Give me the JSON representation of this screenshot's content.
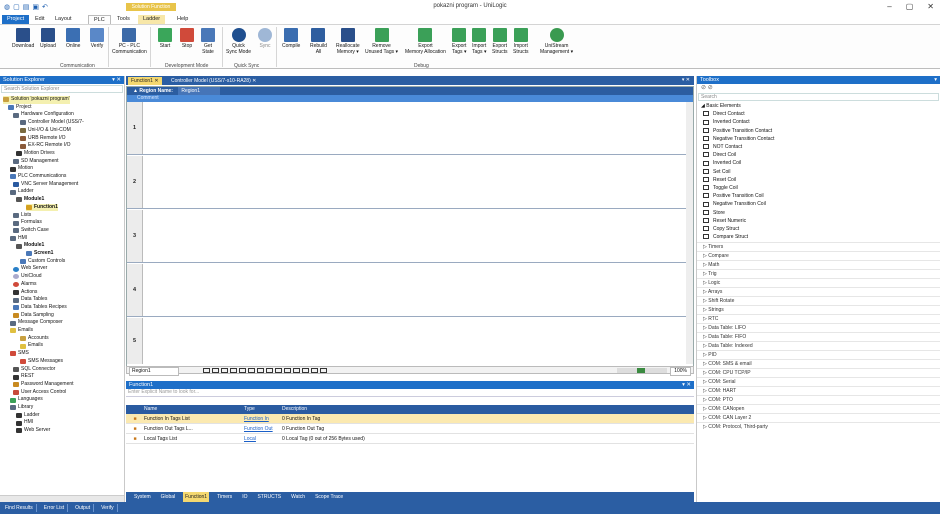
{
  "titlebar": {
    "ctx_tab": "Solution Function",
    "title": "pokazni program - UniLogic",
    "ctrl": [
      "–",
      "▢",
      "✕"
    ]
  },
  "menutabs": [
    "Project",
    "Edit",
    "Layout",
    "PLC",
    "Tools",
    "Ladder",
    "Help"
  ],
  "ribbon": {
    "buttons": [
      "Download",
      "Upload",
      "Online",
      "Verify",
      "PC - PLC\nCommunication",
      "Start",
      "Stop",
      "Get\nState",
      "Quick\nSync Mode",
      "Sync",
      "Compile",
      "Rebuild\nAll",
      "Reallocate\nMemory ▾",
      "Remove\nUnused Tags ▾",
      "Export\nMemory Allocation",
      "Export\nTags ▾",
      "Import\nTags ▾",
      "Export\nStructs",
      "Import\nStructs",
      "UniStream\nManagement ▾"
    ],
    "groups": [
      "Communication",
      "Development Mode",
      "Quick Sync",
      "Debug"
    ]
  },
  "solution": {
    "title": "Solution Explorer",
    "search_placeholder": "Search Solution Explorer",
    "tree": [
      "Solution 'pokazni program'",
      "Project",
      "Hardware Configuration",
      "Controller Model (USS/7-",
      "Uni-I/O & Uni-COM",
      "URB Remote I/O",
      "EX-RC Remote I/O",
      "Motion Drives",
      "SD Management",
      "Motion",
      "PLC Communications",
      "VNC Server Management",
      "Ladder",
      "Module1",
      "Function1",
      "Lists",
      "Formulas",
      "Switch Case",
      "HMI",
      "Module1",
      "Screen1",
      "Custom Controls",
      "Web Server",
      "UniCloud",
      "Alarms",
      "Actions",
      "Data Tables",
      "Data Tables Recipes",
      "Data Sampling",
      "Message Composer",
      "Emails",
      "Accounts",
      "Emails",
      "SMS",
      "SMS Messages",
      "SQL Connector",
      "REST",
      "Password Management",
      "User Access Control",
      "Languages",
      "Library",
      "Ladder",
      "HMI",
      "Web Server"
    ]
  },
  "doctabs": [
    "Function1 ✕",
    "Controller Model (USS/7-s10-RA28) ✕"
  ],
  "ladder": {
    "region_label": "Region Name:",
    "region_value": "Region1",
    "comment": "Comment",
    "rungs": [
      "1",
      "2",
      "3",
      "4",
      "5"
    ],
    "region_select": "Region1",
    "zoom": "100%"
  },
  "function_panel": {
    "title": "Function1",
    "filter_placeholder": "Enter Explicit Name to look for...",
    "headers": [
      "Name",
      "Type",
      "Description"
    ],
    "rows": [
      {
        "name": "Function In Tags List",
        "type": "Function In",
        "desc": "0 Function In Tag"
      },
      {
        "name": "Function Out Tags L...",
        "type": "Function Out",
        "desc": "0 Function Out Tag"
      },
      {
        "name": "Local Tags List",
        "type": "Local",
        "desc": "0 Local Tag (0 out of 256 Bytes used)"
      }
    ]
  },
  "bottom_tabs": [
    "System",
    "Global",
    "Function1",
    "Timers",
    "IO",
    "STRUCTS",
    "Watch",
    "Scope Trace"
  ],
  "status_tabs": [
    "Find Results",
    "Error List",
    "Output",
    "Verify"
  ],
  "toolbox": {
    "title": "Toolbox",
    "search": "Search",
    "section": "Basic Elements",
    "elements": [
      "Direct Contact",
      "Inverted Contact",
      "Positive Transition Contact",
      "Negative Transition Contact",
      "NOT Contact",
      "Direct Coil",
      "Inverted Coil",
      "Set Coil",
      "Reset Coil",
      "Toggle Coil",
      "Positive Transition Coil",
      "Negative Transition Coil",
      "Store",
      "Reset Numeric",
      "Copy Struct",
      "Compare Struct"
    ],
    "categories": [
      "Timers",
      "Compare",
      "Math",
      "Trig",
      "Logic",
      "Arrays",
      "Shift Rotate",
      "Strings",
      "RTC",
      "Data Table: LIFO",
      "Data Table: FIFO",
      "Data Table: Indexed",
      "PID",
      "COM: SMS & email",
      "COM: CPU TCP/IP",
      "COM: Serial",
      "COM: HART",
      "COM: PTO",
      "COM: CANopen",
      "COM: CAN Layer 2",
      "COM: Protocol, Third-party"
    ]
  }
}
